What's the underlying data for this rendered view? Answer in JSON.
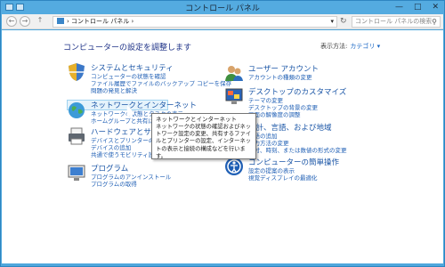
{
  "window": {
    "title": "コントロール パネル",
    "controls": [
      "—",
      "□",
      "✕"
    ]
  },
  "addressbar": {
    "back": "←",
    "forward": "→",
    "up": "↑",
    "path": "› コントロール パネル ›",
    "dropdown": "▾",
    "refresh": "↻",
    "search_placeholder": "コントロール パネルの検索",
    "search_icon": "⚲"
  },
  "content": {
    "heading": "コンピューターの設定を調整します",
    "view_by_label": "表示方法:",
    "view_by_value": "カテゴリ ▾"
  },
  "categories": [
    {
      "title": "システムとセキュリティ",
      "links": [
        "コンピューターの状態を確認",
        "ファイル履歴でファイルのバックアップ コピーを保存",
        "問題の発見と解決"
      ]
    },
    {
      "title": "ネットワークとインターネット",
      "links": [
        "ネットワークの状態とタスクの表示",
        "ホームグループと共有に関するオプションの選択"
      ]
    },
    {
      "title": "ハードウェアとサウンド",
      "links": [
        "デバイスとプリンターの表示",
        "デバイスの追加",
        "共通で使うモビリティ設定の調整"
      ]
    },
    {
      "title": "プログラム",
      "links": [
        "プログラムのアンインストール",
        "プログラムの取得"
      ]
    },
    {
      "title": "ユーザー アカウント",
      "links": [
        "アカウントの種類の変更"
      ]
    },
    {
      "title": "デスクトップのカスタマイズ",
      "links": [
        "テーマの変更",
        "デスクトップの背景の変更",
        "画面の解像度の調整"
      ]
    },
    {
      "title": "時計、言語、および地域",
      "links": [
        "言語の追加",
        "入力方法の変更",
        "日付、時刻、または数値の形式の変更"
      ]
    },
    {
      "title": "コンピューターの簡単操作",
      "links": [
        "設定の提案の表示",
        "視覚ディスプレイの最適化"
      ]
    }
  ],
  "tooltip": {
    "title": "ネットワークとインターネット",
    "body": "ネットワークの状態の確認およびネットワーク設定の変更、共有するファイルとプリンターの設定、インターネットの表示と接続の構成などを行います。"
  }
}
